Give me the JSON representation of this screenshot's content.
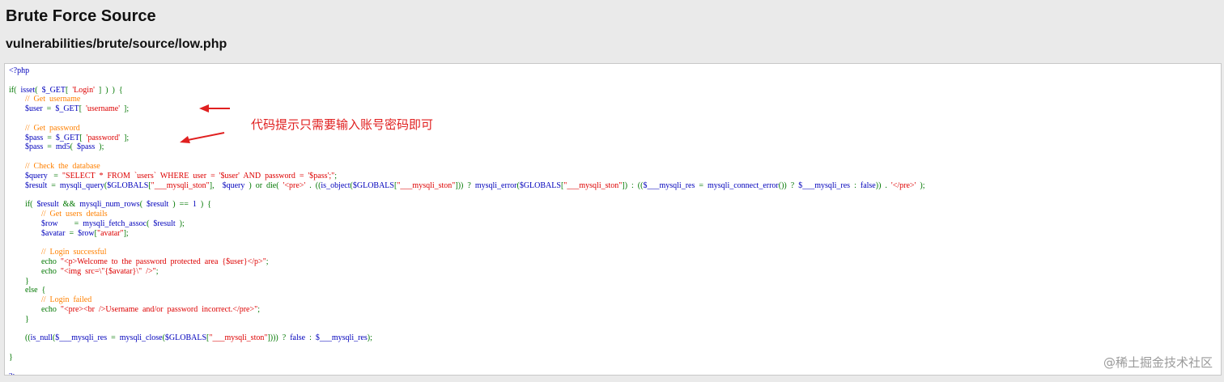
{
  "header": {
    "title": "Brute Force Source",
    "file_path": "vulnerabilities/brute/source/low.php"
  },
  "code": {
    "lines": [
      [
        [
          "d",
          "<?php"
        ]
      ],
      [],
      [
        [
          "k",
          "if(  "
        ],
        [
          "d",
          "isset"
        ],
        [
          "k",
          "(  "
        ],
        [
          "d",
          "$_GET"
        ],
        [
          "k",
          "[  "
        ],
        [
          "s",
          "'Login'"
        ],
        [
          "k",
          "  ]  )  )  {"
        ]
      ],
      [
        [
          "k",
          "        "
        ],
        [
          "c",
          "//  Get  username"
        ]
      ],
      [
        [
          "k",
          "        "
        ],
        [
          "d",
          "$user"
        ],
        [
          "k",
          "  =  "
        ],
        [
          "d",
          "$_GET"
        ],
        [
          "k",
          "[  "
        ],
        [
          "s",
          "'username'"
        ],
        [
          "k",
          "  ];"
        ]
      ],
      [],
      [
        [
          "k",
          "        "
        ],
        [
          "c",
          "//  Get  password"
        ]
      ],
      [
        [
          "k",
          "        "
        ],
        [
          "d",
          "$pass"
        ],
        [
          "k",
          "  =  "
        ],
        [
          "d",
          "$_GET"
        ],
        [
          "k",
          "[  "
        ],
        [
          "s",
          "'password'"
        ],
        [
          "k",
          "  ];"
        ]
      ],
      [
        [
          "k",
          "        "
        ],
        [
          "d",
          "$pass"
        ],
        [
          "k",
          "  =  "
        ],
        [
          "d",
          "md5"
        ],
        [
          "k",
          "(  "
        ],
        [
          "d",
          "$pass"
        ],
        [
          "k",
          "  );"
        ]
      ],
      [],
      [
        [
          "k",
          "        "
        ],
        [
          "c",
          "//  Check  the  database"
        ]
      ],
      [
        [
          "k",
          "        "
        ],
        [
          "d",
          "$query"
        ],
        [
          "k",
          "   =  "
        ],
        [
          "s",
          "\"SELECT  *  FROM  `users`  WHERE  user  =  '$user'  AND  password  =  '$pass';\""
        ],
        [
          "k",
          ";"
        ]
      ],
      [
        [
          "k",
          "        "
        ],
        [
          "d",
          "$result"
        ],
        [
          "k",
          "  =  "
        ],
        [
          "d",
          "mysqli_query"
        ],
        [
          "k",
          "("
        ],
        [
          "d",
          "$GLOBALS"
        ],
        [
          "k",
          "["
        ],
        [
          "s",
          "\"___mysqli_ston\""
        ],
        [
          "k",
          "],    "
        ],
        [
          "d",
          "$query"
        ],
        [
          "k",
          "  )  or  die(  "
        ],
        [
          "s",
          "'<pre>'"
        ],
        [
          "k",
          "  .  (("
        ],
        [
          "d",
          "is_object"
        ],
        [
          "k",
          "("
        ],
        [
          "d",
          "$GLOBALS"
        ],
        [
          "k",
          "["
        ],
        [
          "s",
          "\"___mysqli_ston\""
        ],
        [
          "k",
          "]))  ?  "
        ],
        [
          "d",
          "mysqli_error"
        ],
        [
          "k",
          "("
        ],
        [
          "d",
          "$GLOBALS"
        ],
        [
          "k",
          "["
        ],
        [
          "s",
          "\"___mysqli_ston\""
        ],
        [
          "k",
          "])  :  (("
        ],
        [
          "d",
          "$___mysqli_res"
        ],
        [
          "k",
          "  =  "
        ],
        [
          "d",
          "mysqli_connect_error"
        ],
        [
          "k",
          "())  ?  "
        ],
        [
          "d",
          "$___mysqli_res"
        ],
        [
          "k",
          "  :  "
        ],
        [
          "d",
          "false"
        ],
        [
          "k",
          "))  .  "
        ],
        [
          "s",
          "'</pre>'"
        ],
        [
          "k",
          "  );"
        ]
      ],
      [],
      [
        [
          "k",
          "        if(  "
        ],
        [
          "d",
          "$result"
        ],
        [
          "k",
          "  &&  "
        ],
        [
          "d",
          "mysqli_num_rows"
        ],
        [
          "k",
          "(  "
        ],
        [
          "d",
          "$result"
        ],
        [
          "k",
          "  )  ==  "
        ],
        [
          "d",
          "1"
        ],
        [
          "k",
          "  )  {"
        ]
      ],
      [
        [
          "k",
          "                "
        ],
        [
          "c",
          "//  Get  users  details"
        ]
      ],
      [
        [
          "k",
          "                "
        ],
        [
          "d",
          "$row"
        ],
        [
          "k",
          "        =  "
        ],
        [
          "d",
          "mysqli_fetch_assoc"
        ],
        [
          "k",
          "(  "
        ],
        [
          "d",
          "$result"
        ],
        [
          "k",
          "  );"
        ]
      ],
      [
        [
          "k",
          "                "
        ],
        [
          "d",
          "$avatar"
        ],
        [
          "k",
          "  =  "
        ],
        [
          "d",
          "$row"
        ],
        [
          "k",
          "["
        ],
        [
          "s",
          "\"avatar\""
        ],
        [
          "k",
          "];"
        ]
      ],
      [],
      [
        [
          "k",
          "                "
        ],
        [
          "c",
          "//  Login  successful"
        ]
      ],
      [
        [
          "k",
          "                echo  "
        ],
        [
          "s",
          "\"<p>Welcome  to  the  password  protected  area  {$user}</p>\""
        ],
        [
          "k",
          ";"
        ]
      ],
      [
        [
          "k",
          "                echo  "
        ],
        [
          "s",
          "\"<img  src=\\\"{$avatar}\\\"  />\""
        ],
        [
          "k",
          ";"
        ]
      ],
      [
        [
          "k",
          "        }"
        ]
      ],
      [
        [
          "k",
          "        else  {"
        ]
      ],
      [
        [
          "k",
          "                "
        ],
        [
          "c",
          "//  Login  failed"
        ]
      ],
      [
        [
          "k",
          "                echo  "
        ],
        [
          "s",
          "\"<pre><br  />Username  and/or  password  incorrect.</pre>\""
        ],
        [
          "k",
          ";"
        ]
      ],
      [
        [
          "k",
          "        }"
        ]
      ],
      [],
      [
        [
          "k",
          "        (("
        ],
        [
          "d",
          "is_null"
        ],
        [
          "k",
          "("
        ],
        [
          "d",
          "$___mysqli_res"
        ],
        [
          "k",
          "  =  "
        ],
        [
          "d",
          "mysqli_close"
        ],
        [
          "k",
          "("
        ],
        [
          "d",
          "$GLOBALS"
        ],
        [
          "k",
          "["
        ],
        [
          "s",
          "\"___mysqli_ston\""
        ],
        [
          "k",
          "])))  ?  "
        ],
        [
          "d",
          "false"
        ],
        [
          "k",
          "  :  "
        ],
        [
          "d",
          "$___mysqli_res"
        ],
        [
          "k",
          ");"
        ]
      ],
      [],
      [
        [
          "k",
          "}"
        ]
      ],
      [],
      [
        [
          "d",
          "?>"
        ]
      ]
    ]
  },
  "annotation": {
    "text": "代码提示只需要输入账号密码即可",
    "color": "#e02020"
  },
  "watermark": {
    "text": "@稀土掘金技术社区"
  },
  "colors": {
    "page_background": "#eaeaea",
    "code_default": "#0000bb",
    "code_keyword": "#007700",
    "code_string": "#dd0000",
    "code_comment": "#ff8000"
  }
}
